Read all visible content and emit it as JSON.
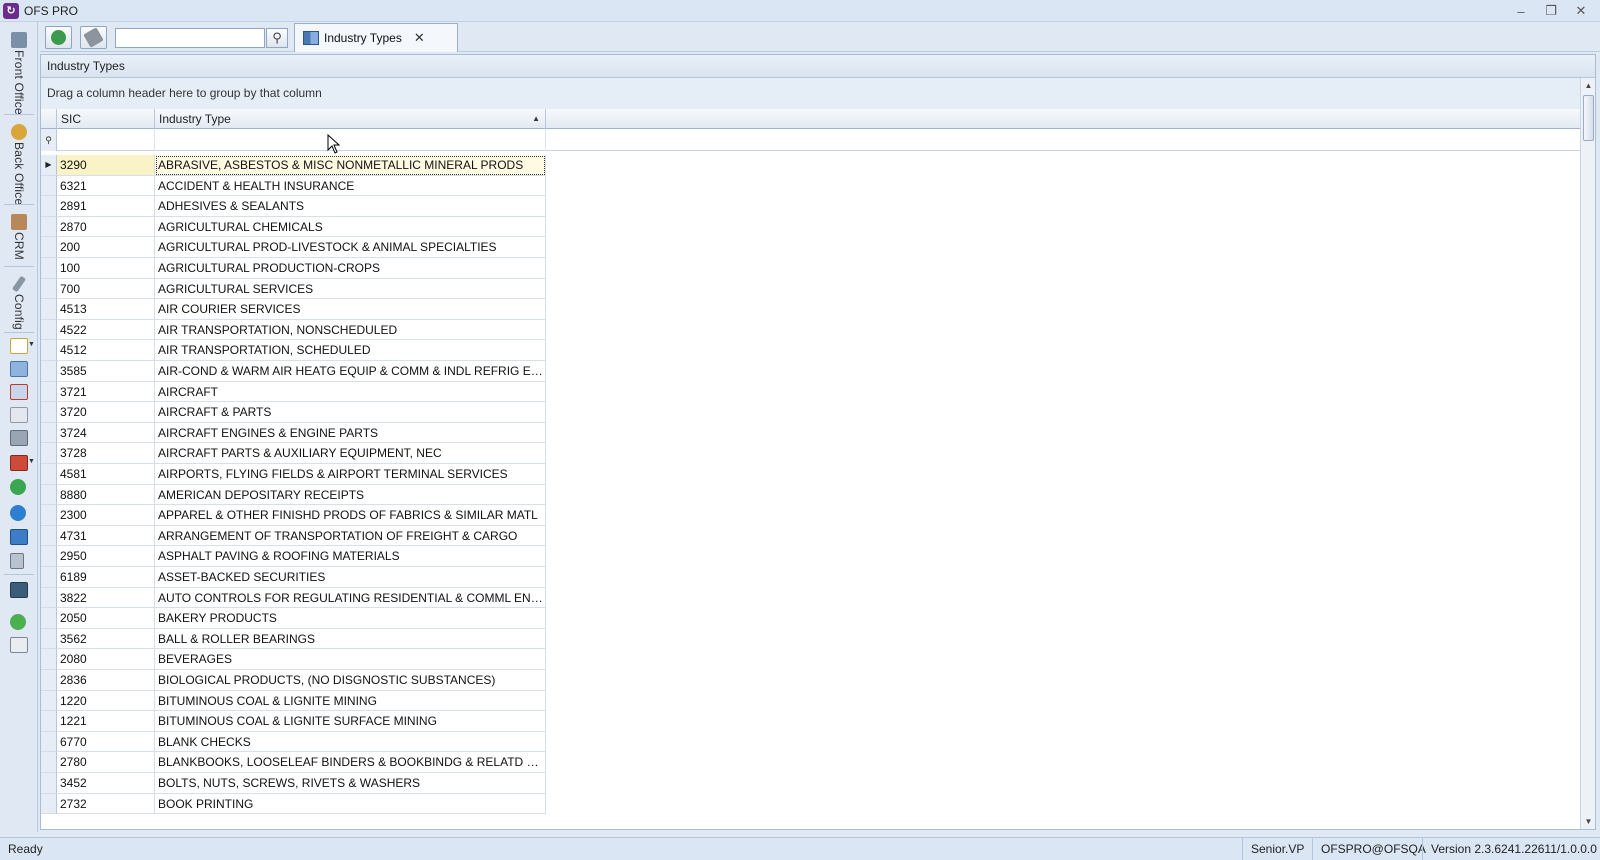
{
  "window": {
    "title": "OFS PRO",
    "logo_glyph": "↻",
    "controls": {
      "minimize": "–",
      "restore": "❐",
      "close": "✕"
    }
  },
  "leftnav": {
    "tabs": [
      {
        "label": "Front Office",
        "icon": "edit-document-icon"
      },
      {
        "label": "Back Office",
        "icon": "coins-icon"
      },
      {
        "label": "CRM",
        "icon": "handshake-icon"
      },
      {
        "label": "Config",
        "icon": "wrench-icon"
      }
    ],
    "tools": [
      "new-document-icon",
      "grid-edit-icon",
      "grid-delete-icon",
      "copy-icon",
      "database-icon",
      "grid-export-icon",
      "refresh-globe-icon",
      "world-icon",
      "windows-icon",
      "calculator-icon",
      "monitor-icon",
      "help-icon",
      "mail-icon"
    ]
  },
  "toolbar": {
    "search": {
      "value": "",
      "placeholder": ""
    },
    "doc_tab": {
      "label": "Industry Types",
      "close": "✕"
    }
  },
  "panel": {
    "caption": "Industry Types",
    "group_hint": "Drag a column header here to group by that column"
  },
  "grid": {
    "columns": [
      {
        "label": "SIC"
      },
      {
        "label": "Industry Type",
        "sort": "ascending"
      }
    ],
    "rows": [
      {
        "sic": "3290",
        "type": "ABRASIVE, ASBESTOS & MISC NONMETALLIC MINERAL PRODS"
      },
      {
        "sic": "6321",
        "type": "ACCIDENT & HEALTH INSURANCE"
      },
      {
        "sic": "2891",
        "type": "ADHESIVES & SEALANTS"
      },
      {
        "sic": "2870",
        "type": "AGRICULTURAL CHEMICALS"
      },
      {
        "sic": "200",
        "type": "AGRICULTURAL PROD-LIVESTOCK & ANIMAL SPECIALTIES"
      },
      {
        "sic": "100",
        "type": "AGRICULTURAL PRODUCTION-CROPS"
      },
      {
        "sic": "700",
        "type": "AGRICULTURAL SERVICES"
      },
      {
        "sic": "4513",
        "type": "AIR COURIER SERVICES"
      },
      {
        "sic": "4522",
        "type": "AIR TRANSPORTATION, NONSCHEDULED"
      },
      {
        "sic": "4512",
        "type": "AIR TRANSPORTATION, SCHEDULED"
      },
      {
        "sic": "3585",
        "type": "AIR-COND & WARM AIR HEATG EQUIP & COMM & INDL REFRIG EQUIP"
      },
      {
        "sic": "3721",
        "type": "AIRCRAFT"
      },
      {
        "sic": "3720",
        "type": "AIRCRAFT & PARTS"
      },
      {
        "sic": "3724",
        "type": "AIRCRAFT ENGINES & ENGINE PARTS"
      },
      {
        "sic": "3728",
        "type": "AIRCRAFT PARTS & AUXILIARY EQUIPMENT, NEC"
      },
      {
        "sic": "4581",
        "type": "AIRPORTS, FLYING FIELDS & AIRPORT TERMINAL SERVICES"
      },
      {
        "sic": "8880",
        "type": "AMERICAN DEPOSITARY RECEIPTS"
      },
      {
        "sic": "2300",
        "type": "APPAREL & OTHER FINISHD PRODS OF FABRICS & SIMILAR MATL"
      },
      {
        "sic": "4731",
        "type": "ARRANGEMENT OF TRANSPORTATION OF FREIGHT & CARGO"
      },
      {
        "sic": "2950",
        "type": "ASPHALT PAVING & ROOFING MATERIALS"
      },
      {
        "sic": "6189",
        "type": "ASSET-BACKED SECURITIES"
      },
      {
        "sic": "3822",
        "type": "AUTO CONTROLS FOR REGULATING RESIDENTIAL & COMML ENVIRONME..."
      },
      {
        "sic": "2050",
        "type": "BAKERY PRODUCTS"
      },
      {
        "sic": "3562",
        "type": "BALL & ROLLER BEARINGS"
      },
      {
        "sic": "2080",
        "type": "BEVERAGES"
      },
      {
        "sic": "2836",
        "type": "BIOLOGICAL PRODUCTS, (NO DISGNOSTIC SUBSTANCES)"
      },
      {
        "sic": "1220",
        "type": "BITUMINOUS COAL & LIGNITE MINING"
      },
      {
        "sic": "1221",
        "type": "BITUMINOUS COAL & LIGNITE SURFACE MINING"
      },
      {
        "sic": "6770",
        "type": "BLANK CHECKS"
      },
      {
        "sic": "2780",
        "type": "BLANKBOOKS, LOOSELEAF BINDERS & BOOKBINDG & RELATD WORK"
      },
      {
        "sic": "3452",
        "type": "BOLTS, NUTS, SCREWS, RIVETS & WASHERS"
      },
      {
        "sic": "2732",
        "type": "BOOK PRINTING"
      }
    ],
    "focused_row_indicator": "▶"
  },
  "statusbar": {
    "state": "Ready",
    "user": "Senior.VP",
    "connection": "OFSPRO@OFSQA",
    "version": "Version 2.3.6241.22611/1.0.0.0"
  },
  "colors": {
    "logo": "#6a2c8e",
    "focused_row": "#fffbe3",
    "chrome": "#dfe8f3"
  }
}
